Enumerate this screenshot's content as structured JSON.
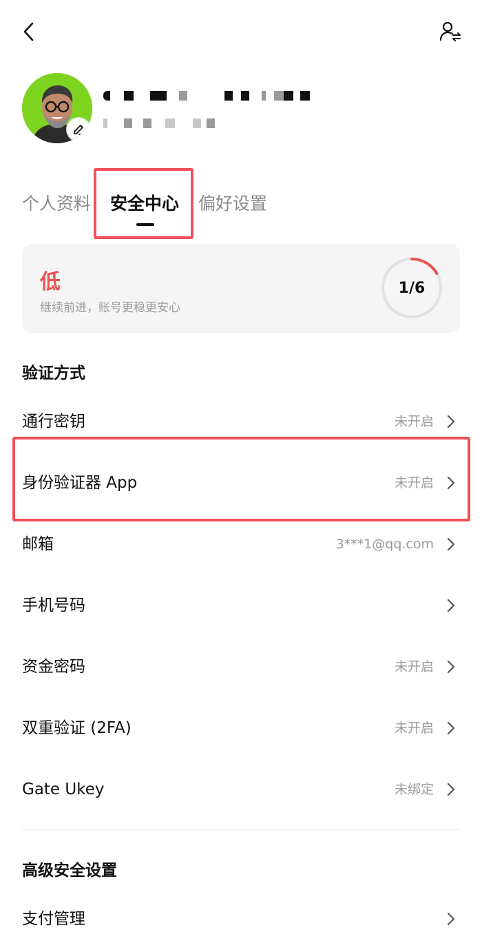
{
  "tabs": [
    {
      "label": "个人资料",
      "active": false
    },
    {
      "label": "安全中心",
      "active": true
    },
    {
      "label": "偏好设置",
      "active": false
    }
  ],
  "security_level": {
    "level": "低",
    "subtitle": "继续前进，账号更稳更安心",
    "progress_text": "1/6",
    "progress_fraction": 0.1667,
    "level_color": "#e8524f"
  },
  "verification": {
    "title": "验证方式",
    "items": [
      {
        "label": "通行密钥",
        "value": "未开启",
        "icon": "chevron-right-icon"
      },
      {
        "label": "身份验证器 App",
        "value": "未开启",
        "icon": "chevron-right-icon"
      },
      {
        "label": "邮箱",
        "value": "3***1@qq.com",
        "icon": "chevron-right-icon"
      },
      {
        "label": "手机号码",
        "value": "",
        "icon": "chevron-right-icon"
      },
      {
        "label": "资金密码",
        "value": "未开启",
        "icon": "chevron-right-icon"
      },
      {
        "label": "双重验证 (2FA)",
        "value": "未开启",
        "icon": "chevron-right-icon"
      },
      {
        "label": "Gate Ukey",
        "value": "未绑定",
        "icon": "chevron-right-icon"
      }
    ]
  },
  "advanced": {
    "title": "高级安全设置",
    "items": [
      {
        "label": "支付管理",
        "value": "",
        "icon": "chevron-right-icon"
      }
    ]
  },
  "icons": {
    "back": "back-arrow-icon",
    "switch_account": "switch-account-icon",
    "edit": "edit-pencil-icon"
  },
  "colors": {
    "accent_red": "#e8524f",
    "highlight_box": "#f0505a",
    "avatar_bg": "#7ed321"
  }
}
